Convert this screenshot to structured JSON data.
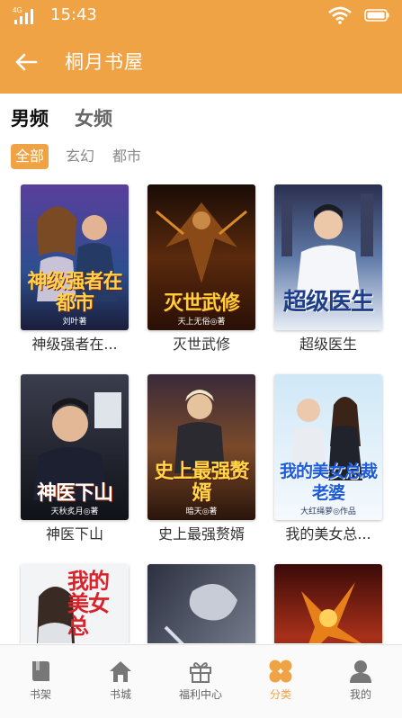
{
  "status_bar": {
    "network": "4G",
    "time": "15:43"
  },
  "nav": {
    "title": "桐月书屋"
  },
  "gender_tabs": [
    {
      "label": "男频",
      "active": true
    },
    {
      "label": "女频",
      "active": false
    }
  ],
  "genres": [
    {
      "label": "全部",
      "active": true
    },
    {
      "label": "玄幻",
      "active": false
    },
    {
      "label": "都市",
      "active": false
    }
  ],
  "books": [
    {
      "title": "神级强者在...",
      "cover_text": "神级强者在都市",
      "cover_author": "刘叶著"
    },
    {
      "title": "灭世武修",
      "cover_text": "灭世武修",
      "cover_author": "天上无俗◎著"
    },
    {
      "title": "超级医生",
      "cover_text": "超级医生",
      "cover_author": ""
    },
    {
      "title": "神医下山",
      "cover_text": "神医下山",
      "cover_author": "天秋炙月◎著"
    },
    {
      "title": "史上最强赘婿",
      "cover_text": "史上最强赘婿",
      "cover_author": "暗天◎著"
    },
    {
      "title": "我的美女总...",
      "cover_text": "我的美女总裁老婆",
      "cover_author": "大红绳萝◎作品"
    },
    {
      "title": "",
      "cover_text": "我的美女总",
      "cover_author": ""
    },
    {
      "title": "",
      "cover_text": "",
      "cover_author": ""
    },
    {
      "title": "",
      "cover_text": "",
      "cover_author": ""
    }
  ],
  "tab_bar": [
    {
      "label": "书架",
      "icon": "book-icon",
      "active": false
    },
    {
      "label": "书城",
      "icon": "house-icon",
      "active": false
    },
    {
      "label": "福利中心",
      "icon": "gift-icon",
      "active": false
    },
    {
      "label": "分类",
      "icon": "category-grid-icon",
      "active": true
    },
    {
      "label": "我的",
      "icon": "profile-icon",
      "active": false
    }
  ],
  "colors": {
    "accent": "#f0a345",
    "text_dark": "#111111",
    "text_muted": "#888888"
  }
}
